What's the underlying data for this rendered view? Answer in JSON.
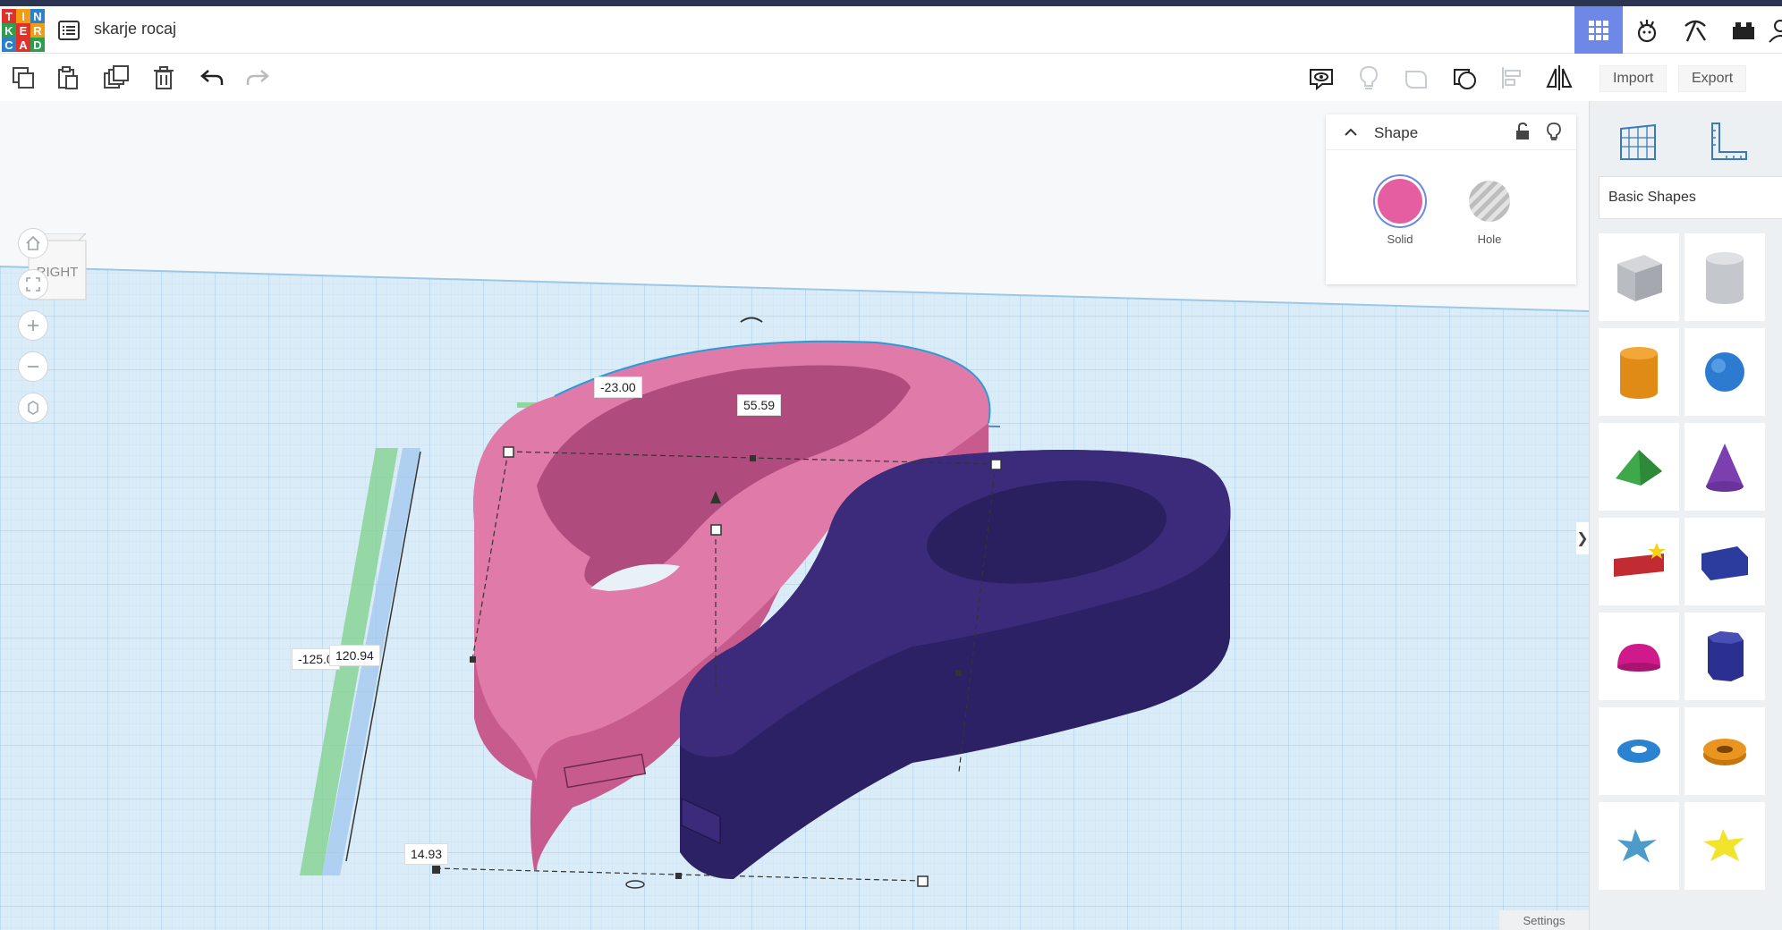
{
  "app": {
    "logo_letters": [
      "T",
      "I",
      "N",
      "K",
      "E",
      "R",
      "C",
      "A",
      "D"
    ],
    "logo_colors": [
      "#e2302b",
      "#f39c12",
      "#2c82c9",
      "#2aa04d",
      "#e2302b",
      "#f39c12",
      "#2c82c9",
      "#e2302b",
      "#2aa04d"
    ],
    "project_title": "skarje rocaj"
  },
  "toolbar": {
    "import_label": "Import",
    "export_label": "Export"
  },
  "viewcube": {
    "face_label": "RIGHT"
  },
  "shape_panel": {
    "title": "Shape",
    "solid_label": "Solid",
    "hole_label": "Hole",
    "solid_color": "#e55ea2"
  },
  "library": {
    "category": "Basic Shapes"
  },
  "dimensions": {
    "offset_x": "-23.00",
    "width": "55.59",
    "length_left": "-125.0",
    "length": "120.94",
    "height": "14.93"
  },
  "footer": {
    "settings_label": "Settings"
  },
  "colors": {
    "pink_shape": "#e07aa8",
    "purple_shape": "#3b2b7a",
    "grid_line": "#b9d9ee",
    "accent_active": "#6e88e8"
  }
}
